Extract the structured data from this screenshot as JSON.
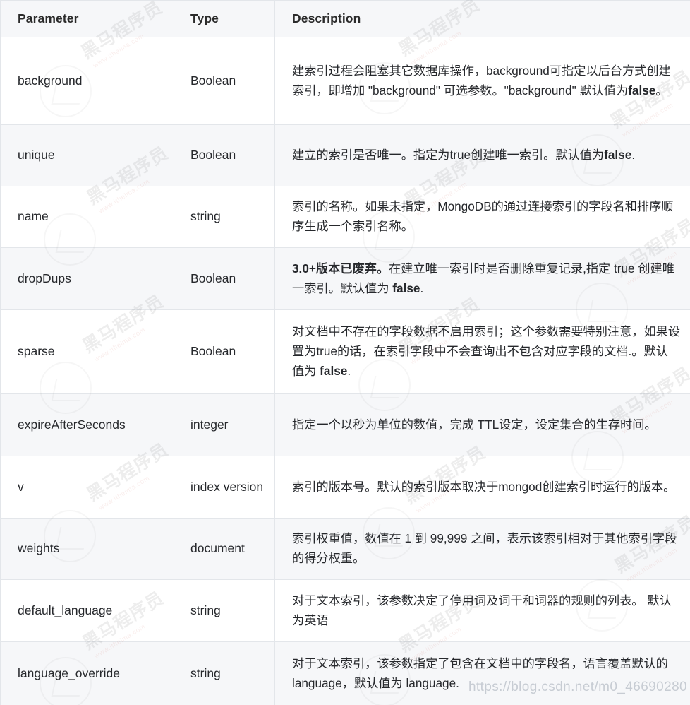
{
  "table": {
    "headers": {
      "parameter": "Parameter",
      "type": "Type",
      "description": "Description"
    },
    "rows": [
      {
        "parameter": "background",
        "type": "Boolean",
        "description": "建索引过程会阻塞其它数据库操作，background可指定以后台方式创建索引，即增加 \"background\" 可选参数。\"background\" 默认值为false。",
        "description_html": "建索引过程会阻塞其它数据库操作，background可指定以后台方式创建索引，即增加 \"background\" 可选参数。\"background\" 默认值为<b>false</b>。"
      },
      {
        "parameter": "unique",
        "type": "Boolean",
        "description": "建立的索引是否唯一。指定为true创建唯一索引。默认值为false.",
        "description_html": "建立的索引是否唯一。指定为true创建唯一索引。默认值为<b>false</b>."
      },
      {
        "parameter": "name",
        "type": "string",
        "description": "索引的名称。如果未指定，MongoDB的通过连接索引的字段名和排序顺序生成一个索引名称。",
        "description_html": "索引的名称。如果未指定，MongoDB的通过连接索引的字段名和排序顺序生成一个索引名称。"
      },
      {
        "parameter": "dropDups",
        "type": "Boolean",
        "description": "3.0+版本已废弃。在建立唯一索引时是否删除重复记录,指定 true 创建唯一索引。默认值为 false.",
        "description_html": "<b>3.0+版本已废弃。</b>在建立唯一索引时是否删除重复记录,指定 true 创建唯一索引。默认值为 <b>false</b>."
      },
      {
        "parameter": "sparse",
        "type": "Boolean",
        "description": "对文档中不存在的字段数据不启用索引；这个参数需要特别注意，如果设置为true的话，在索引字段中不会查询出不包含对应字段的文档.。默认值为 false.",
        "description_html": "对文档中不存在的字段数据不启用索引；这个参数需要特别注意，如果设置为true的话，在索引字段中不会查询出不包含对应字段的文档.。默认值为 <b>false</b>."
      },
      {
        "parameter": "expireAfterSeconds",
        "type": "integer",
        "description": "指定一个以秒为单位的数值，完成 TTL设定，设定集合的生存时间。",
        "description_html": "指定一个以秒为单位的数值，完成 TTL设定，设定集合的生存时间。"
      },
      {
        "parameter": "v",
        "type": "index version",
        "description": "索引的版本号。默认的索引版本取决于mongod创建索引时运行的版本。",
        "description_html": "索引的版本号。默认的索引版本取决于mongod创建索引时运行的版本。"
      },
      {
        "parameter": "weights",
        "type": "document",
        "description": "索引权重值，数值在 1 到 99,999 之间，表示该索引相对于其他索引字段的得分权重。",
        "description_html": "索引权重值，数值在 1 到 99,999 之间，表示该索引相对于其他索引字段的得分权重。"
      },
      {
        "parameter": "default_language",
        "type": "string",
        "description": "对于文本索引，该参数决定了停用词及词干和词器的规则的列表。 默认为英语",
        "description_html": "对于文本索引，该参数决定了停用词及词干和词器的规则的列表。 默认为英语"
      },
      {
        "parameter": "language_override",
        "type": "string",
        "description": "对于文本索引，该参数指定了包含在文档中的字段名，语言覆盖默认的language，默认值为 language.",
        "description_html": "对于文本索引，该参数指定了包含在文档中的字段名，语言覆盖默认的language，默认值为 language."
      }
    ]
  },
  "watermarks": {
    "brand_cn": "黑马程序员",
    "brand_url": "www.itheima.com",
    "source_url": "https://blog.csdn.net/m0_46690280"
  },
  "colors": {
    "header_bg": "#f6f7f9",
    "row_alt_bg": "#f6f7f9",
    "row_bg": "#ffffff",
    "border": "#e3e6ea",
    "text": "#26282c",
    "watermark_url": "#c7ccd3"
  }
}
